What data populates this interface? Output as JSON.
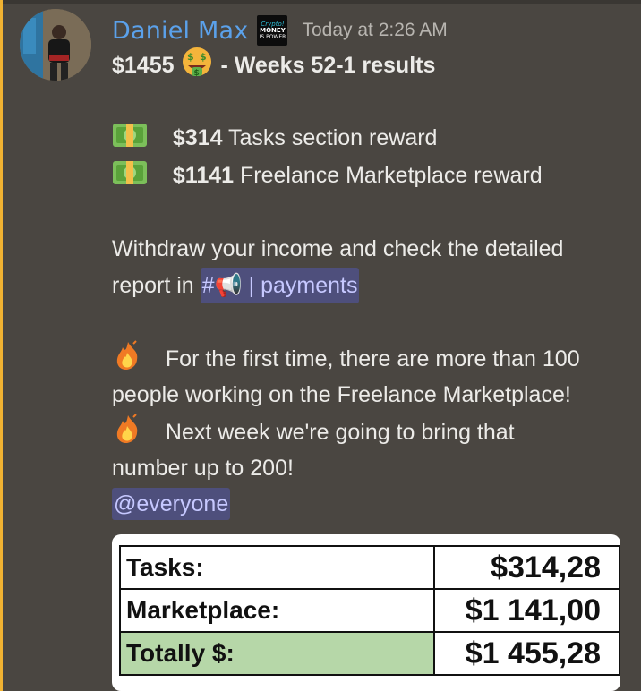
{
  "message": {
    "username": "Daniel Max",
    "badge": {
      "line1": "Crypto!",
      "line2": "MONEY",
      "line3": "IS POWER"
    },
    "timestamp": "Today at 2:26 AM",
    "title_amount": "$1455",
    "title_rest": " - Weeks 52-1 results",
    "rewards": [
      {
        "amount": "$314",
        "label": " Tasks section reward"
      },
      {
        "amount": "$1141",
        "label": " Freelance Marketplace reward"
      }
    ],
    "withdraw_line1": "Withdraw your income and check the detailed",
    "withdraw_prefix": "report in ",
    "channel": "#📢 | payments",
    "fire_line1": "For the first time, there are more than 100",
    "fire_line2": "people working on the Freelance Marketplace!",
    "fire_line3": "Next week we're going to bring that",
    "fire_line4": "number up to 200!",
    "mention": "@everyone"
  },
  "table": {
    "rows": [
      {
        "label": "Tasks:",
        "value": "$314,28"
      },
      {
        "label": "Marketplace:",
        "value": "$1 141,00"
      },
      {
        "label": "Totally $:",
        "value": "$1 455,28"
      }
    ],
    "total_row_color": "#b6d7a8"
  },
  "colors": {
    "username": "#5ba1ea",
    "mention_bg": "#4e4f7c",
    "background": "#4a4641"
  },
  "icons": [
    "avatar-photo",
    "crypto-money-badge-icon",
    "money-mouth-face-emoji",
    "dollar-banknote-emoji",
    "megaphone-emoji",
    "fire-emoji"
  ]
}
